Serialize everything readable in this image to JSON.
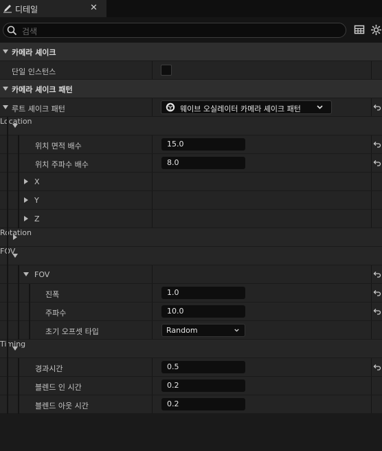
{
  "tab": {
    "title": "디테일",
    "close": "✕"
  },
  "search": {
    "placeholder": "검색"
  },
  "rows": {
    "cat1": "카메라 셰이크",
    "single_instance": "단일 인스턴스",
    "cat2": "카메라 셰이크 패턴",
    "root_pattern": "루트 셰이크 패턴",
    "root_pattern_value": "웨이브 오실레이터 카메라 셰이크 패턴",
    "location": "Location",
    "loc_amp_mult": "위치 면적 배수",
    "loc_amp_mult_value": "15.0",
    "loc_freq_mult": "위치 주파수 배수",
    "loc_freq_mult_value": "8.0",
    "x": "X",
    "y": "Y",
    "z": "Z",
    "rotation": "Rotation",
    "fov_group": "FOV",
    "fov_sub": "FOV",
    "amplitude": "진폭",
    "amplitude_value": "1.0",
    "frequency": "주파수",
    "frequency_value": "10.0",
    "init_offset": "초기 오프셋 타입",
    "init_offset_value": "Random",
    "timing": "Timing",
    "duration": "경과시간",
    "duration_value": "0.5",
    "blend_in": "블렌드 인 시간",
    "blend_in_value": "0.2",
    "blend_out": "블렌드 아웃 시간",
    "blend_out_value": "0.2"
  },
  "colors": {
    "background": "#1a1a1a",
    "category": "#2e2e2e",
    "row": "#242424",
    "field": "#0e0e0e"
  }
}
